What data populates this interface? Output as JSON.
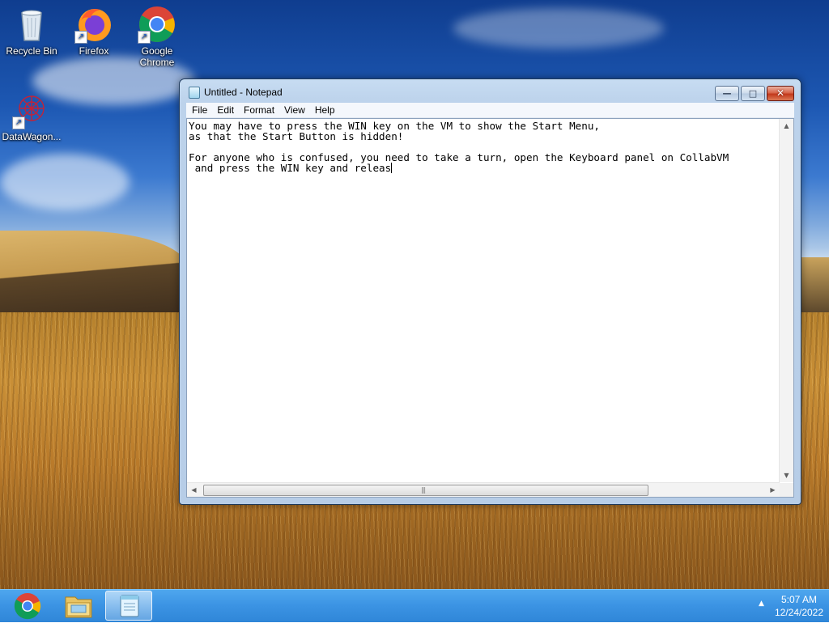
{
  "desktop": {
    "icons": [
      {
        "label": "Recycle Bin",
        "icon": "recycle-bin-icon"
      },
      {
        "label": "Firefox",
        "icon": "firefox-icon",
        "shortcut": true
      },
      {
        "label": "Google\nChrome",
        "icon": "chrome-icon",
        "shortcut": true
      },
      {
        "label": "DataWagon...",
        "icon": "datawagon-icon",
        "shortcut": true
      }
    ]
  },
  "window": {
    "title": "Untitled - Notepad",
    "buttons": {
      "minimize": "minimize",
      "maximize": "maximize",
      "close": "close"
    },
    "menu": [
      "File",
      "Edit",
      "Format",
      "View",
      "Help"
    ],
    "content_lines": [
      "You may have to press the WIN key on the VM to show the Start Menu,",
      "as that the Start Button is hidden!",
      "",
      "For anyone who is confused, you need to take a turn, open the Keyboard panel on CollabVM",
      " and press the WIN key and releas"
    ]
  },
  "taskbar": {
    "items": [
      {
        "name": "chrome",
        "icon": "chrome-icon",
        "active": false
      },
      {
        "name": "file-explorer",
        "icon": "folder-icon",
        "active": false
      },
      {
        "name": "notepad",
        "icon": "notepad-icon",
        "active": true
      }
    ],
    "clock": {
      "time": "5:07 AM",
      "date": "12/24/2022"
    }
  },
  "colors": {
    "taskbar": "#3b93e3",
    "window_frame": "#bcd2eb",
    "close_button": "#c2381b"
  }
}
